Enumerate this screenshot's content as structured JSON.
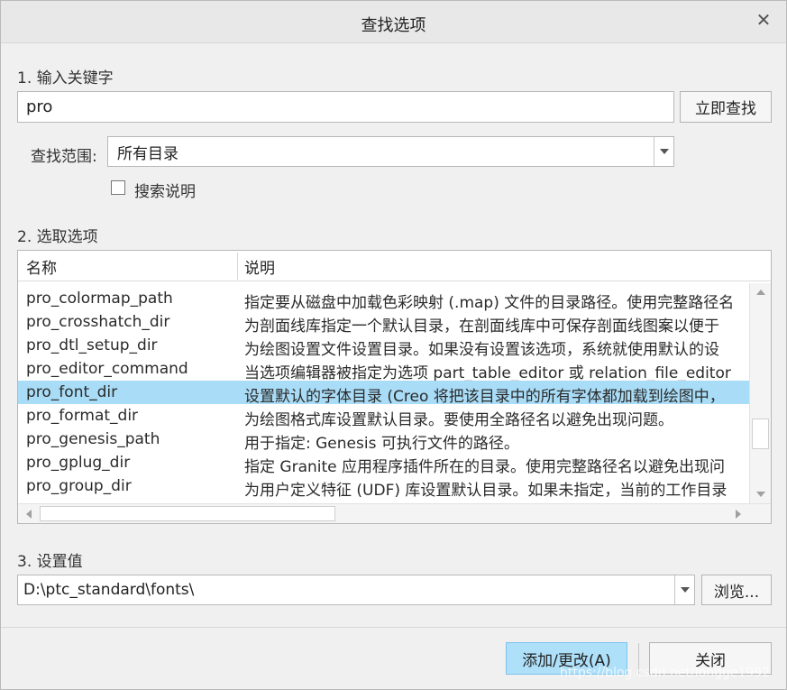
{
  "window": {
    "title": "查找选项",
    "close_label": "✕"
  },
  "step1": {
    "label": "1. 输入关键字",
    "keyword_value": "pro",
    "search_button": "立即查找",
    "scope_label": "查找范围:",
    "scope_value": "所有目录",
    "search_desc_label": "搜索说明"
  },
  "step2": {
    "label": "2. 选取选项",
    "columns": {
      "name": "名称",
      "desc": "说明"
    },
    "rows": [
      {
        "name": "pro_colormap_path",
        "desc": "指定要从磁盘中加载色彩映射 (.map) 文件的目录路径。使用完整路径名"
      },
      {
        "name": "pro_crosshatch_dir",
        "desc": "为剖面线库指定一个默认目录，在剖面线库中可保存剖面线图案以便于"
      },
      {
        "name": "pro_dtl_setup_dir",
        "desc": "为绘图设置文件设置目录。如果没有设置该选项，系统就使用默认的设"
      },
      {
        "name": "pro_editor_command",
        "desc": "当选项编辑器被指定为选项 part_table_editor 或 relation_file_editor"
      },
      {
        "name": "pro_font_dir",
        "desc": "设置默认的字体目录 (Creo 将把该目录中的所有字体都加载到绘图中，"
      },
      {
        "name": "pro_format_dir",
        "desc": "为绘图格式库设置默认目录。要使用全路径名以避免出现问题。"
      },
      {
        "name": "pro_genesis_path",
        "desc": "用于指定: Genesis 可执行文件的路径。"
      },
      {
        "name": "pro_gplug_dir",
        "desc": "指定 Granite 应用程序插件所在的目录。使用完整路径名以避免出现问"
      },
      {
        "name": "pro_group_dir",
        "desc": "为用户定义特征 (UDF) 库设置默认目录。如果未指定，当前的工作目录"
      }
    ],
    "selected_row": "pro_font_dir"
  },
  "step3": {
    "label": "3. 设置值",
    "value": "D:\\ptc_standard\\fonts\\",
    "browse_button": "浏览..."
  },
  "footer": {
    "add_button": "添加/更改(A)",
    "close_button": "关闭",
    "watermark": "https://blog.csdn.net/longge1992"
  },
  "colors": {
    "selected_row": "#a9dcf6",
    "primary_button": "#aee0f9"
  }
}
